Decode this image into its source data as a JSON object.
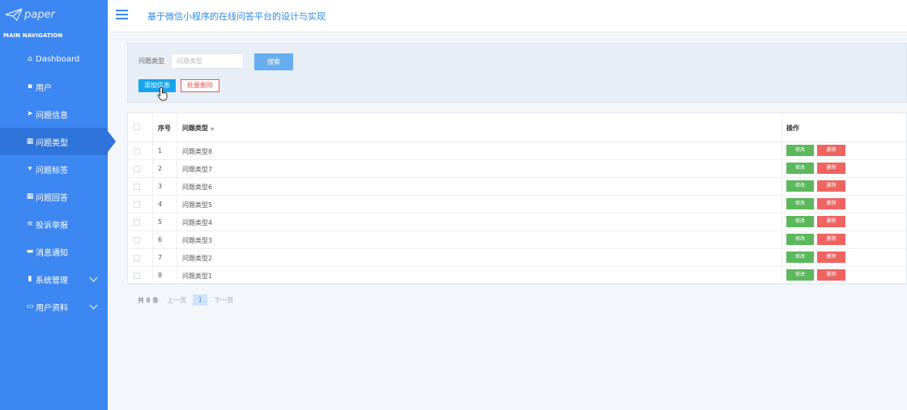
{
  "brand": {
    "logo_text": "paper",
    "logo_icon": "paper-plane-icon"
  },
  "sidebar": {
    "section_title": "MAIN NAVIGATION",
    "items": [
      {
        "label": "Dashboard",
        "icon": "home-icon",
        "glyph": "⌂",
        "active": false,
        "expandable": false
      },
      {
        "label": "用户",
        "icon": "chat-icon",
        "glyph": "▪",
        "active": false,
        "expandable": false
      },
      {
        "label": "问题信息",
        "icon": "send-icon",
        "glyph": "➤",
        "active": false,
        "expandable": false
      },
      {
        "label": "问题类型",
        "icon": "grid-icon",
        "glyph": "▦",
        "active": true,
        "expandable": false
      },
      {
        "label": "问题标签",
        "icon": "trophy-icon",
        "glyph": "▾",
        "active": false,
        "expandable": false
      },
      {
        "label": "问题回答",
        "icon": "grid-icon",
        "glyph": "▦",
        "active": false,
        "expandable": false
      },
      {
        "label": "投诉举报",
        "icon": "list-icon",
        "glyph": "≡",
        "active": false,
        "expandable": false
      },
      {
        "label": "消息通知",
        "icon": "monitor-icon",
        "glyph": "▬",
        "active": false,
        "expandable": false
      },
      {
        "label": "系统管理",
        "icon": "building-icon",
        "glyph": "▮",
        "active": false,
        "expandable": true
      },
      {
        "label": "用户资料",
        "icon": "card-icon",
        "glyph": "▭",
        "active": false,
        "expandable": true
      }
    ]
  },
  "header": {
    "title": "基于微信小程序的在线问答平台的设计与实现",
    "menu_icon": "hamburger-icon"
  },
  "search": {
    "label": "问题类型",
    "placeholder": "问题类型",
    "search_button": "搜索",
    "add_button": "添加信息",
    "bulk_delete_button": "批量删除"
  },
  "table": {
    "columns": {
      "index": "序号",
      "type": "问题类型",
      "actions": "操作"
    },
    "edit_label": "修改",
    "delete_label": "删除",
    "rows": [
      {
        "index": "1",
        "type": "问题类型8"
      },
      {
        "index": "2",
        "type": "问题类型7"
      },
      {
        "index": "3",
        "type": "问题类型6"
      },
      {
        "index": "4",
        "type": "问题类型5"
      },
      {
        "index": "5",
        "type": "问题类型4"
      },
      {
        "index": "6",
        "type": "问题类型3"
      },
      {
        "index": "7",
        "type": "问题类型2"
      },
      {
        "index": "8",
        "type": "问题类型1"
      }
    ]
  },
  "pagination": {
    "total": "共 8 条",
    "prev": "上一页",
    "current": "1",
    "next": "下一页"
  },
  "colors": {
    "sidebar": "#3d87f2",
    "active": "#2f74da",
    "title": "#2f8ae6",
    "edit": "#5cb85c",
    "delete": "#ef6461",
    "add": "#16a5ee"
  }
}
